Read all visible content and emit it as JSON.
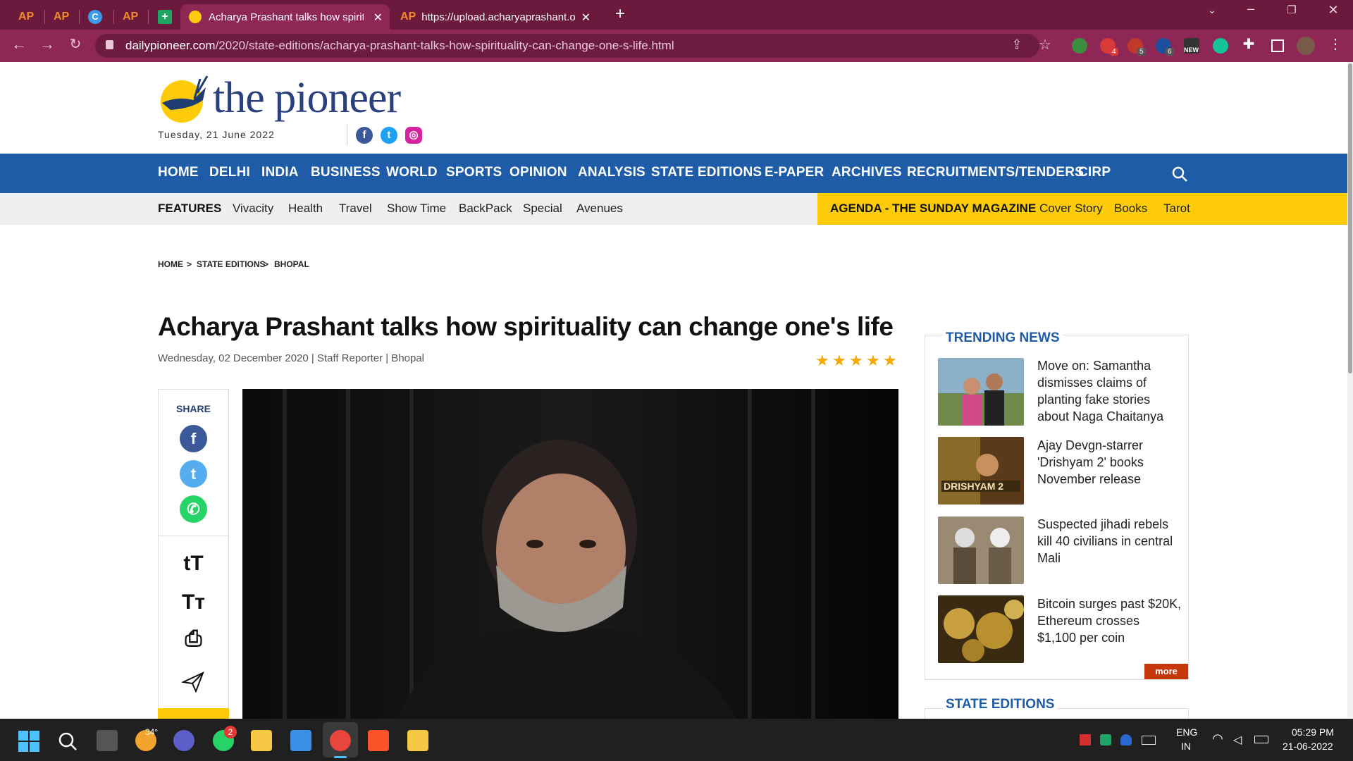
{
  "browser": {
    "tabs": [
      {
        "label": "AP",
        "favicon": "ap-icon"
      },
      {
        "label": "AP",
        "favicon": "ap-icon"
      },
      {
        "label": "",
        "favicon": "c-icon"
      },
      {
        "label": "AP",
        "favicon": "ap-icon"
      },
      {
        "label": "",
        "favicon": "sheets-icon"
      },
      {
        "label": "Acharya Prashant talks how spirit",
        "favicon": "pioneer-icon",
        "active": true
      },
      {
        "label": "https://upload.acharyaprashant.o",
        "favicon": "ap-icon"
      }
    ],
    "url_host": "dailypioneer.com",
    "url_path": "/2020/state-editions/acharya-prashant-talks-how-spirituality-can-change-one-s-life.html",
    "ext_badges": [
      "4",
      "5",
      "6",
      "NEW"
    ]
  },
  "site": {
    "logo_text": "the pioneer",
    "date": "Tuesday, 21 June 2022",
    "nav": [
      "HOME",
      "DELHI",
      "INDIA",
      "BUSINESS",
      "WORLD",
      "SPORTS",
      "OPINION",
      "ANALYSIS",
      "STATE EDITIONS",
      "E-PAPER",
      "ARCHIVES",
      "RECRUITMENTS/TENDERS",
      "CIRP"
    ],
    "subnav_features": "FEATURES",
    "subnav": [
      "Vivacity",
      "Health",
      "Travel",
      "Show Time",
      "BackPack",
      "Special",
      "Avenues"
    ],
    "agenda": "AGENDA - THE SUNDAY MAGAZINE",
    "agenda_links": [
      "Cover Story",
      "Books",
      "Tarot"
    ]
  },
  "breadcrumb": [
    "HOME",
    "STATE EDITIONS",
    "BHOPAL"
  ],
  "article": {
    "headline": "Acharya Prashant talks how spirituality can change one's life",
    "byline": "Wednesday, 02 December 2020 | Staff Reporter | Bhopal",
    "rating": 5
  },
  "share": {
    "label": "SHARE",
    "tools": [
      "tT",
      "Tт"
    ]
  },
  "trending": {
    "title": "TRENDING NEWS",
    "items": [
      "Move on: Samantha dismisses claims of planting fake stories about Naga Chaitanya",
      "Ajay Devgn-starrer 'Drishyam 2' books November release",
      "Suspected jihadi rebels kill 40 civilians in central Mali",
      "Bitcoin surges past $20K, Ethereum crosses $1,100 per coin"
    ],
    "more": "more",
    "drishyam_poster_text": "DRISHYAM 2"
  },
  "state_editions_title": "STATE EDITIONS",
  "taskbar": {
    "weather": "34°",
    "whatsapp_badge": "2",
    "lang1": "ENG",
    "lang2": "IN",
    "time": "05:29 PM",
    "date": "21-06-2022"
  },
  "colors": {
    "nav_blue": "#1f5ca8",
    "agenda_yellow": "#fdcb08",
    "tab_bar": "#6b1a3d",
    "more_red": "#c8370c"
  }
}
